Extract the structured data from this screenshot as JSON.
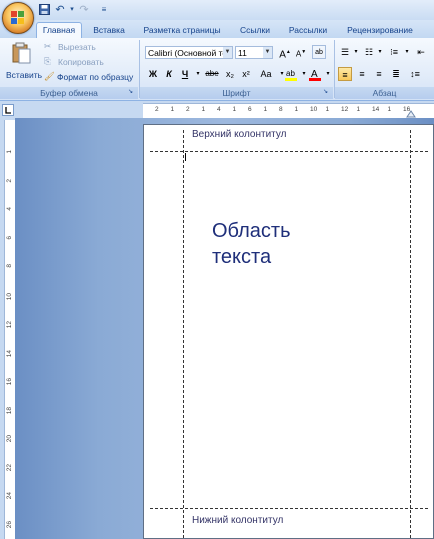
{
  "tabs": [
    "Главная",
    "Вставка",
    "Разметка страницы",
    "Ссылки",
    "Рассылки",
    "Рецензирование"
  ],
  "clipboard": {
    "paste_label": "Вставить",
    "cut_label": "Вырезать",
    "copy_label": "Копировать",
    "format_painter_label": "Формат по образцу",
    "group_label": "Буфер обмена"
  },
  "font": {
    "font_name": "Calibri (Основной те",
    "font_size": "11",
    "group_label": "Шрифт",
    "bold": "Ж",
    "italic": "К",
    "underline": "Ч",
    "strike": "abe",
    "subscript": "x₂",
    "superscript": "x²",
    "change_case": "Aa"
  },
  "paragraph": {
    "group_label": "Абзац"
  },
  "ruler_h_ticks": [
    "2",
    "1",
    "2",
    "1",
    "4",
    "1",
    "6",
    "1",
    "8",
    "1",
    "10",
    "1",
    "12",
    "1",
    "14",
    "1",
    "16"
  ],
  "ruler_v_ticks": [
    "1",
    "2",
    "4",
    "6",
    "8",
    "10",
    "12",
    "14",
    "16",
    "18",
    "20",
    "22",
    "24",
    "26"
  ],
  "document": {
    "header_text": "Верхний колонтитул",
    "body_line1": "Область",
    "body_line2": "текста",
    "footer_text": "Нижний колонтитул"
  },
  "colors": {
    "accent": "#15428b",
    "highlight": "#ffff00",
    "font_color": "#ff0000"
  }
}
